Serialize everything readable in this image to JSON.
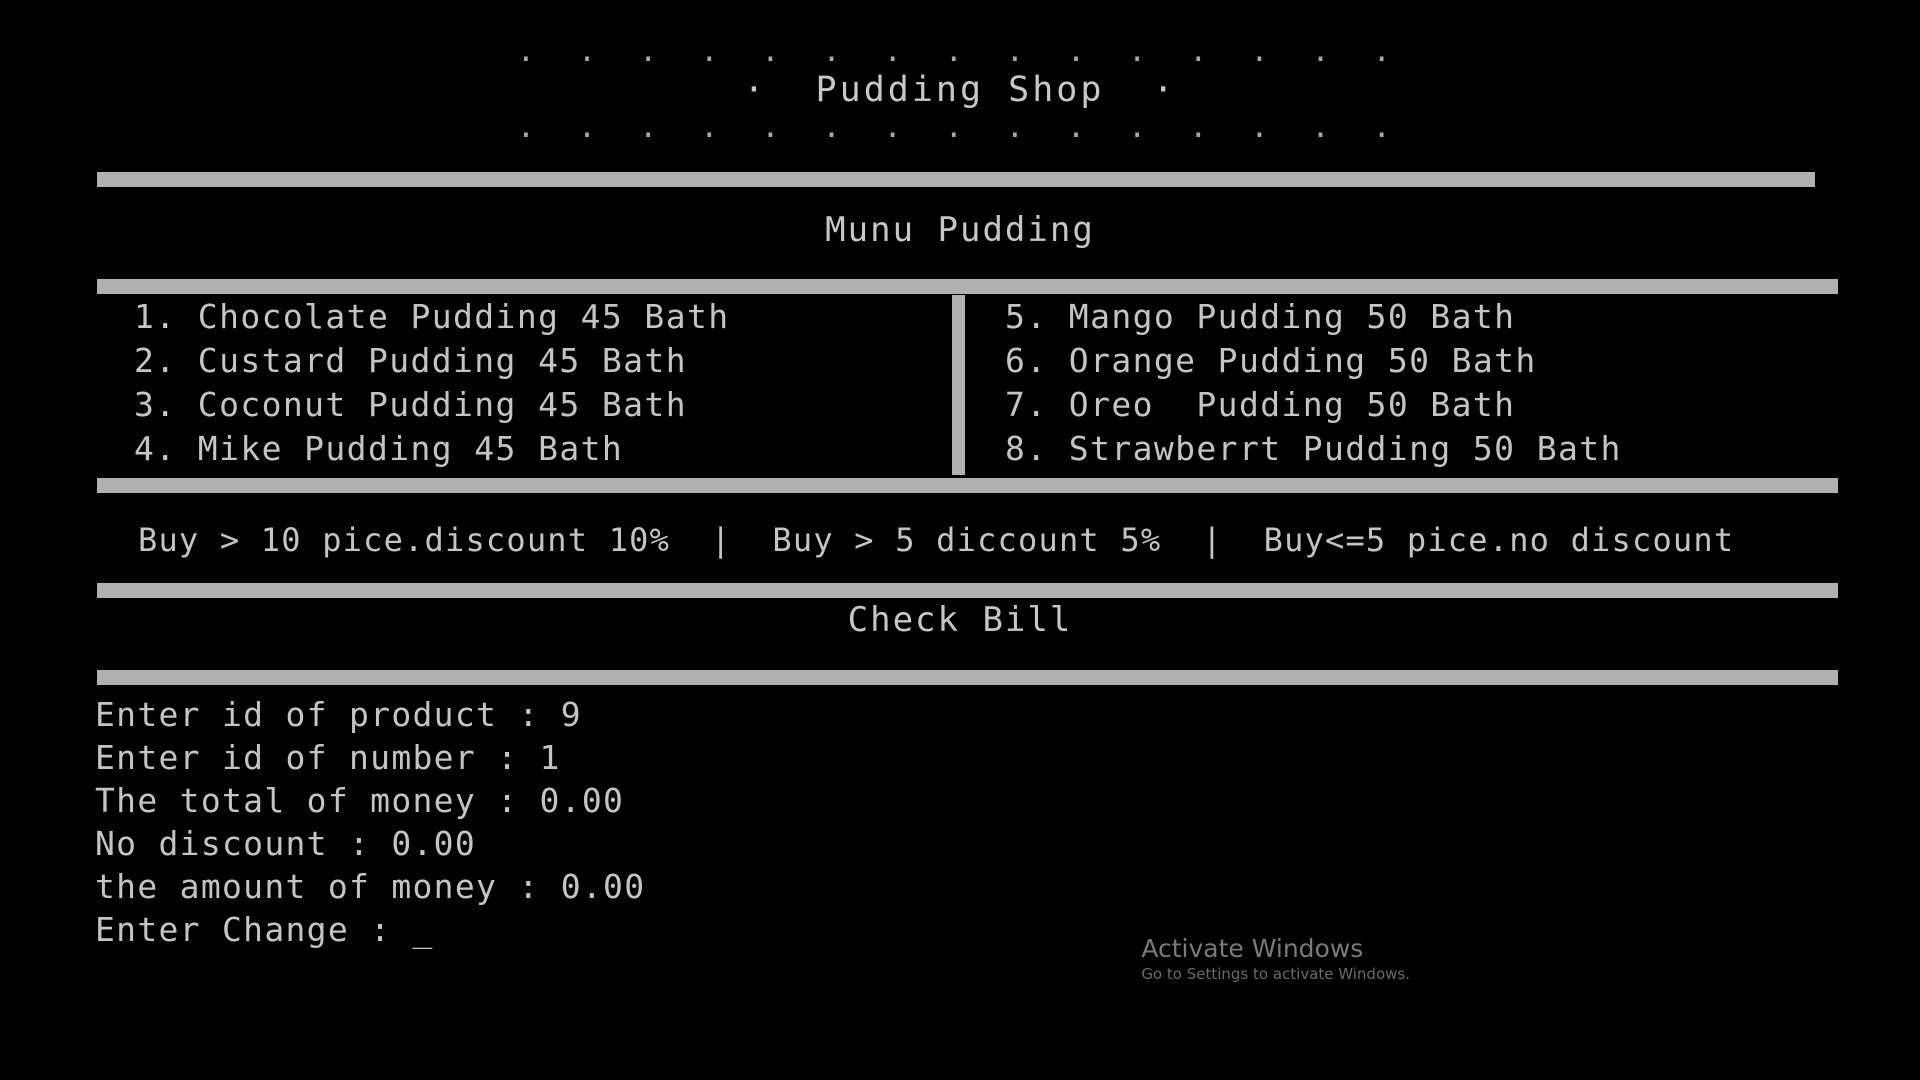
{
  "window": {
    "title": "Pudding Shop",
    "background_color": "#000000",
    "text_color": "#c4c4c4",
    "rule_color": "#b0b0b0"
  },
  "banner": {
    "top_dots": ". . . . . . . . . . . . . . .",
    "title_line": "·  Pudding Shop  ·",
    "bottom_dots": ". . . . . . . . . . . . . . ."
  },
  "menu": {
    "heading": "Munu Pudding",
    "left_column": [
      "1. Chocolate Pudding 45 Bath",
      "2. Custard Pudding 45 Bath",
      "3. Coconut Pudding 45 Bath",
      "4. Mike Pudding 45 Bath"
    ],
    "right_column": [
      "5. Mango Pudding 50 Bath",
      "6. Orange Pudding 50 Bath",
      "7. Oreo  Pudding 50 Bath",
      "8. Strawberrt Pudding 50 Bath"
    ]
  },
  "discount": {
    "line": "Buy > 10 pice.discount 10%  |  Buy > 5 diccount 5%  |  Buy<=5 pice.no discount"
  },
  "bill": {
    "heading": "Check Bill",
    "lines": [
      "Enter id of product : 9",
      "Enter id of number : 1",
      "The total of money : 0.00",
      "No discount : 0.00",
      "the amount of money : 0.00"
    ],
    "prompt_label": "Enter Change : ",
    "prompt_cursor": "_"
  },
  "watermark": {
    "title": "Activate Windows",
    "subtitle": "Go to Settings to activate Windows."
  }
}
